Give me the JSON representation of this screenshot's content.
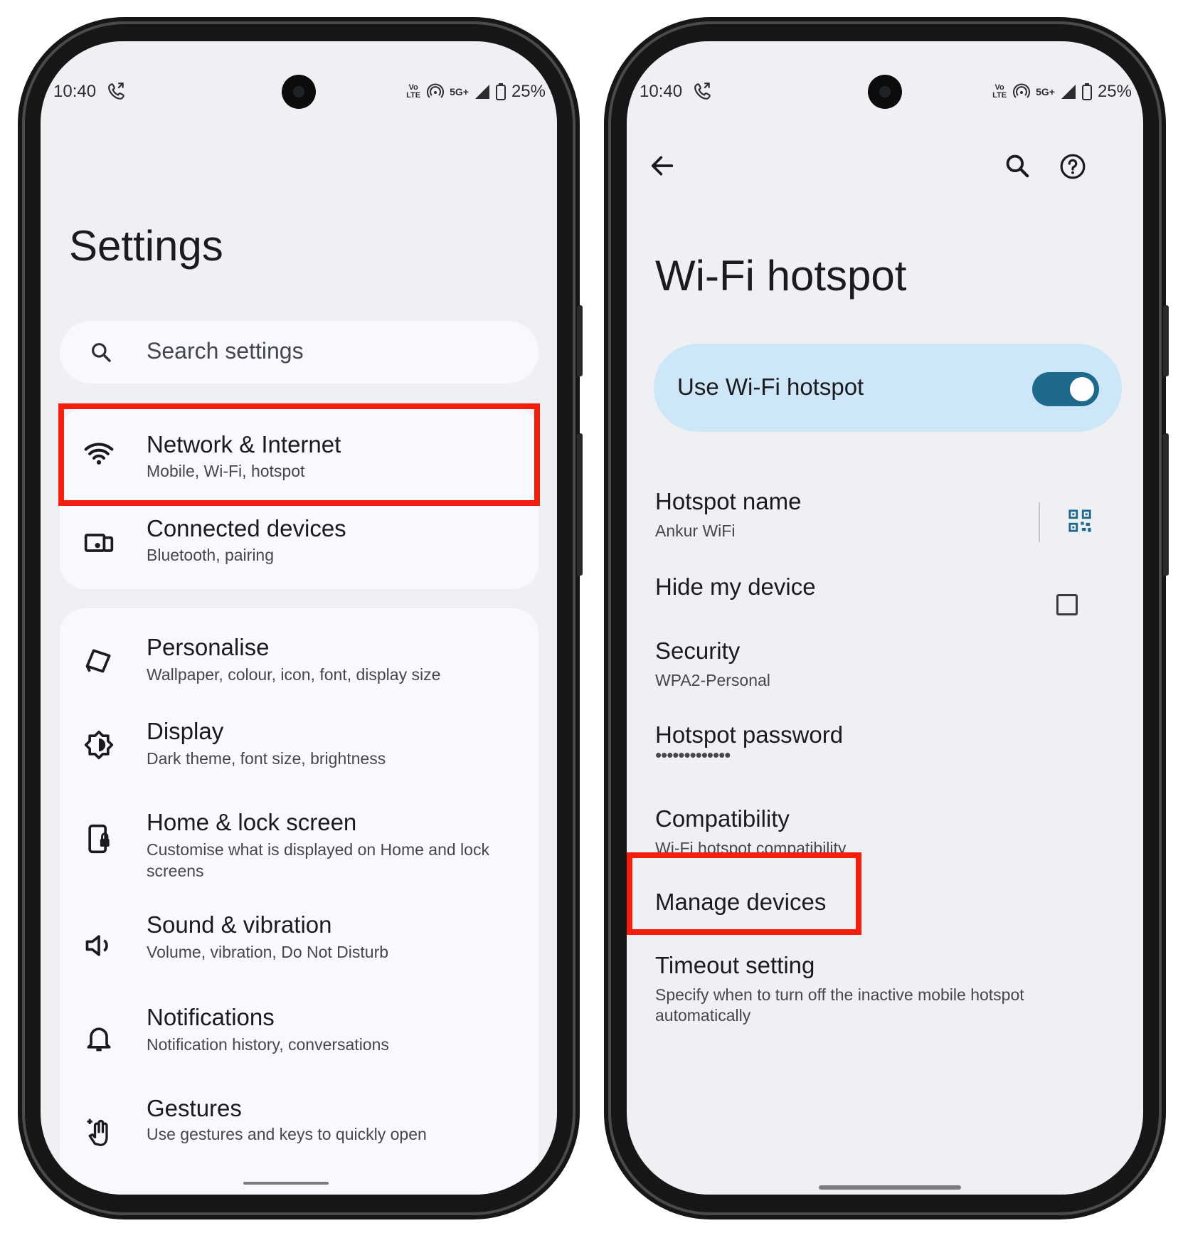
{
  "left": {
    "status": {
      "time": "10:40",
      "net1": "Vo LTE",
      "net2": "5G+",
      "battery": "25%"
    },
    "title": "Settings",
    "search": {
      "placeholder": "Search settings"
    },
    "items": [
      {
        "title": "Network & Internet",
        "subtitle": "Mobile, Wi-Fi, hotspot",
        "icon": "wifi-icon"
      },
      {
        "title": "Connected devices",
        "subtitle": "Bluetooth, pairing",
        "icon": "devices-icon"
      },
      {
        "title": "Personalise",
        "subtitle": "Wallpaper, colour, icon, font, display size",
        "icon": "palette-icon"
      },
      {
        "title": "Display",
        "subtitle": "Dark theme, font size, brightness",
        "icon": "brightness-icon"
      },
      {
        "title": "Home & lock screen",
        "subtitle": "Customise what is displayed on Home and lock screens",
        "icon": "lock-screen-icon"
      },
      {
        "title": "Sound & vibration",
        "subtitle": "Volume, vibration, Do Not Disturb",
        "icon": "speaker-icon"
      },
      {
        "title": "Notifications",
        "subtitle": "Notification history, conversations",
        "icon": "bell-icon"
      },
      {
        "title": "Gestures",
        "subtitle": "Use gestures and keys to quickly open",
        "icon": "gesture-icon"
      }
    ]
  },
  "right": {
    "status": {
      "time": "10:40",
      "net1": "Vo LTE",
      "net2": "5G+",
      "battery": "25%"
    },
    "title": "Wi-Fi hotspot",
    "toggle": {
      "label": "Use Wi-Fi hotspot",
      "on": true
    },
    "hotspot_name": {
      "title": "Hotspot name",
      "value": "Ankur WiFi"
    },
    "hide_device": {
      "title": "Hide my device",
      "checked": false
    },
    "security": {
      "title": "Security",
      "value": "WPA2-Personal"
    },
    "password": {
      "title": "Hotspot password",
      "value": "•••••••••••••"
    },
    "compatibility": {
      "title": "Compatibility",
      "value": "Wi-Fi hotspot compatibility"
    },
    "manage": {
      "title": "Manage devices"
    },
    "timeout": {
      "title": "Timeout setting",
      "value": "Specify when to turn off the inactive mobile hotspot automatically"
    }
  },
  "colors": {
    "highlight": "#f51d0c",
    "toggle_track": "#1d6a8c",
    "toggle_card": "#cde6f8",
    "screen_bg": "#eff0f4",
    "card_bg": "#f8f9fd"
  }
}
